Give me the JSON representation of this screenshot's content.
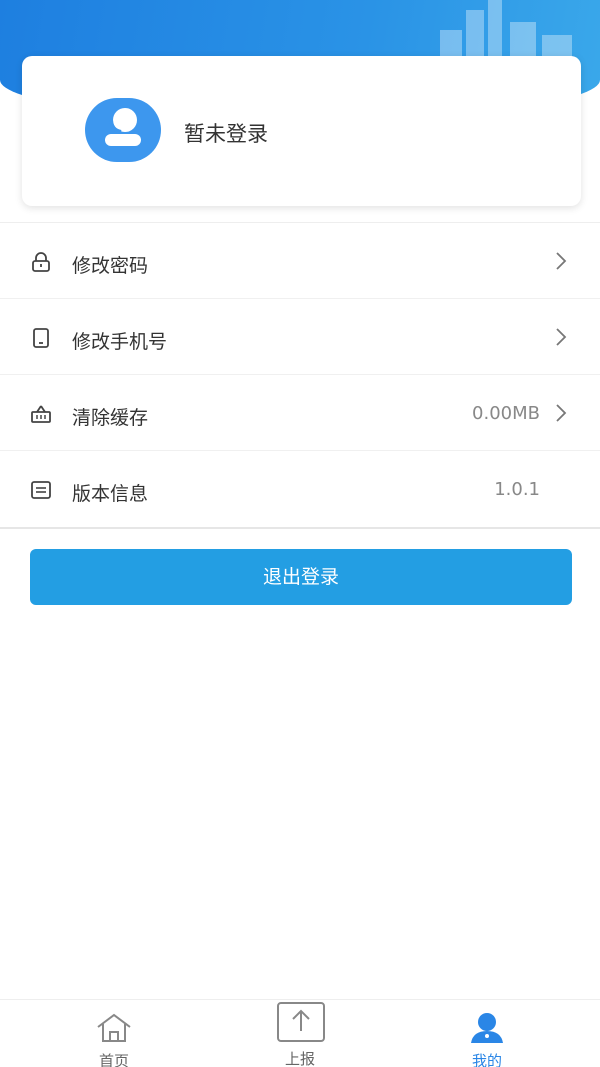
{
  "profile": {
    "name": "暂未登录",
    "avatar_icon": "user-avatar-icon"
  },
  "menu": {
    "items": [
      {
        "label": "修改密码",
        "icon": "lock-icon",
        "value": "",
        "has_chevron": true
      },
      {
        "label": "修改手机号",
        "icon": "phone-icon",
        "value": "",
        "has_chevron": true
      },
      {
        "label": "清除缓存",
        "icon": "basket-icon",
        "value": "0.00MB",
        "has_chevron": true
      },
      {
        "label": "版本信息",
        "icon": "info-list-icon",
        "value": "1.0.1",
        "has_chevron": false
      }
    ]
  },
  "logout": {
    "label": "退出登录"
  },
  "tabbar": {
    "tabs": [
      {
        "label": "首页",
        "icon": "home-icon",
        "active": false
      },
      {
        "label": "上报",
        "icon": "upload-icon",
        "active": false
      },
      {
        "label": "我的",
        "icon": "user-icon",
        "active": true
      }
    ]
  },
  "colors": {
    "primary": "#239ee3",
    "header": "#1e7fe0",
    "active_tab": "#2a86e6",
    "inactive_tab": "#666666"
  }
}
